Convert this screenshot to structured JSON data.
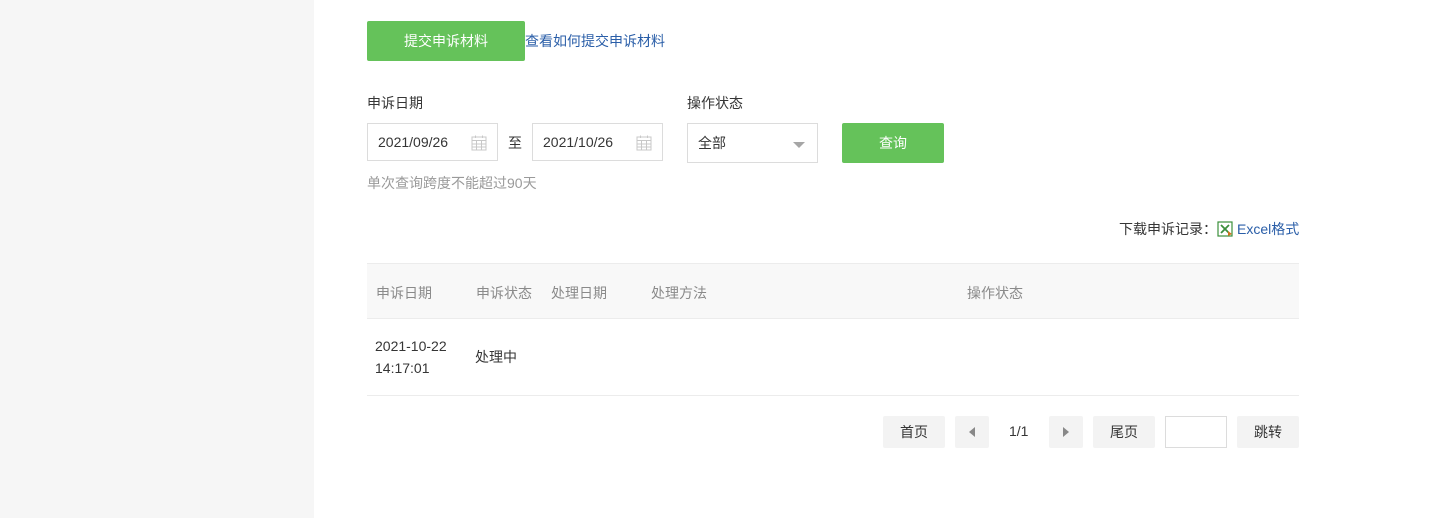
{
  "toolbar": {
    "submit_label": "提交申诉材料",
    "help_link": "查看如何提交申诉材料"
  },
  "filters": {
    "date_label": "申诉日期",
    "start_date": "2021/09/26",
    "to_label": "至",
    "end_date": "2021/10/26",
    "status_label": "操作状态",
    "status_value": "全部",
    "query_label": "查询",
    "hint": "单次查询跨度不能超过90天"
  },
  "download": {
    "label": "下载申诉记录：",
    "format_link": "Excel格式"
  },
  "table": {
    "columns": [
      "申诉日期",
      "申诉状态",
      "处理日期",
      "处理方法",
      "操作状态"
    ],
    "rows": [
      {
        "date_line1": "2021-10-22",
        "date_line2": "14:17:01",
        "status": "处理中",
        "handle_date": "",
        "method": "",
        "op_status": ""
      }
    ]
  },
  "pagination": {
    "first": "首页",
    "page_info": "1/1",
    "last": "尾页",
    "jump_value": "",
    "jump": "跳转"
  },
  "colors": {
    "accent": "#65c25a",
    "link": "#2a5ea8",
    "sidebar": "#f6f6f6"
  }
}
